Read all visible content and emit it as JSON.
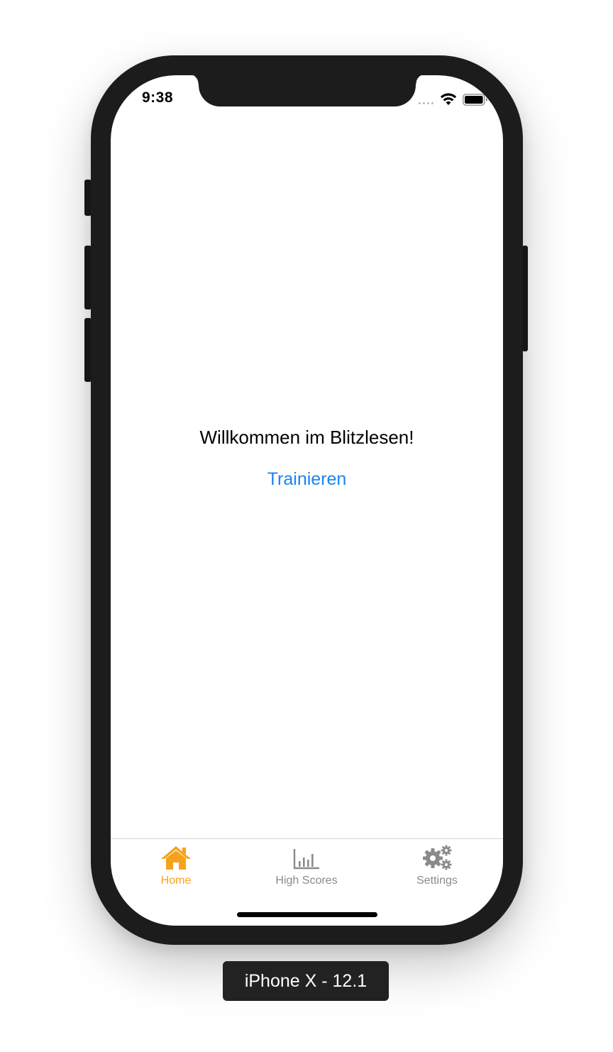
{
  "device": {
    "caption": "iPhone X - 12.1"
  },
  "status_bar": {
    "time": "9:38",
    "icons": [
      "cellular-signal-icon",
      "wifi-icon",
      "battery-icon"
    ]
  },
  "main": {
    "welcome_text": "Willkommen im Blitzlesen!",
    "train_label": "Trainieren"
  },
  "tab_bar": {
    "items": [
      {
        "label": "Home",
        "icon": "house-icon",
        "active": true
      },
      {
        "label": "High Scores",
        "icon": "bar-chart-icon",
        "active": false
      },
      {
        "label": "Settings",
        "icon": "gears-icon",
        "active": false
      }
    ]
  },
  "colors": {
    "accent_active": "#f7a21c",
    "link": "#1a84f0",
    "inactive": "#8a8a8a",
    "frame": "#1c1c1c"
  }
}
